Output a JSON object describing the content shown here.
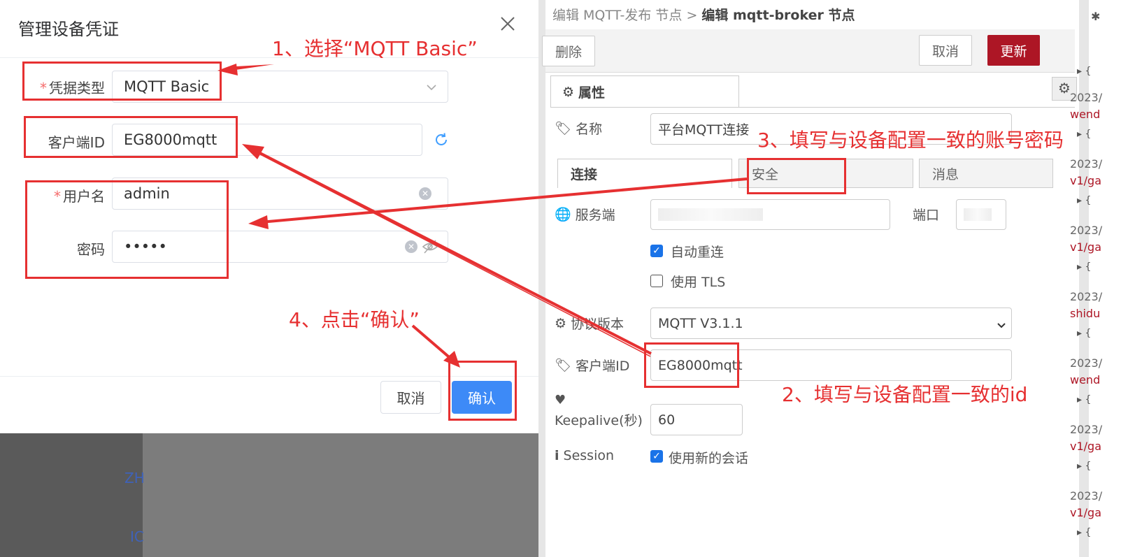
{
  "dialog": {
    "title": "管理设备凭证",
    "fields": {
      "credential_type": {
        "label": "凭据类型",
        "value": "MQTT Basic"
      },
      "client_id": {
        "label": "客户端ID",
        "value": "EG8000mqtt"
      },
      "username": {
        "label": "用户名",
        "value": "admin"
      },
      "password": {
        "label": "密码",
        "value": "•••••"
      }
    },
    "required_mark": "*",
    "cancel_label": "取消",
    "confirm_label": "确认"
  },
  "background": {
    "text1": "ZH",
    "text2": "IC"
  },
  "editor": {
    "breadcrumb_prefix": "编辑 MQTT-发布 节点 >",
    "breadcrumb_current": "编辑 mqtt-broker 节点",
    "delete_label": "删除",
    "cancel_label": "取消",
    "update_label": "更新",
    "properties_tab": "属性",
    "name_label": "名称",
    "name_value": "平台MQTT连接",
    "tabs": [
      "连接",
      "安全",
      "消息"
    ],
    "server_label": "服务端",
    "port_label": "端口",
    "auto_reconnect_label": "自动重连",
    "use_tls_label": "使用 TLS",
    "protocol_label": "协议版本",
    "protocol_value": "MQTT V3.1.1",
    "client_id_label": "客户端ID",
    "client_id_value": "EG8000mqtt",
    "keepalive_label": "Keepalive(秒)",
    "keepalive_value": "60",
    "session_label": "Session",
    "new_session_label": "使用新的会话",
    "accent_color": "#ad1625"
  },
  "sidebar": {
    "entries": [
      {
        "date": "2023/",
        "topic": "wend"
      },
      {
        "date": "2023/",
        "topic": "v1/ga"
      },
      {
        "date": "2023/",
        "topic": "v1/ga"
      },
      {
        "date": "2023/",
        "topic": "shidu"
      },
      {
        "date": "2023/",
        "topic": "wend"
      },
      {
        "date": "2023/",
        "topic": "v1/ga"
      },
      {
        "date": "2023/",
        "topic": "v1/ga"
      }
    ],
    "brace": "{",
    "header_icon": "bug-icon"
  },
  "annotations": {
    "step1": "1、选择“MQTT Basic”",
    "step2": "2、填写与设备配置一致的id",
    "step3": "3、填写与设备配置一致的账号密码",
    "step4": "4、点击“确认”",
    "color": "#e63031"
  }
}
